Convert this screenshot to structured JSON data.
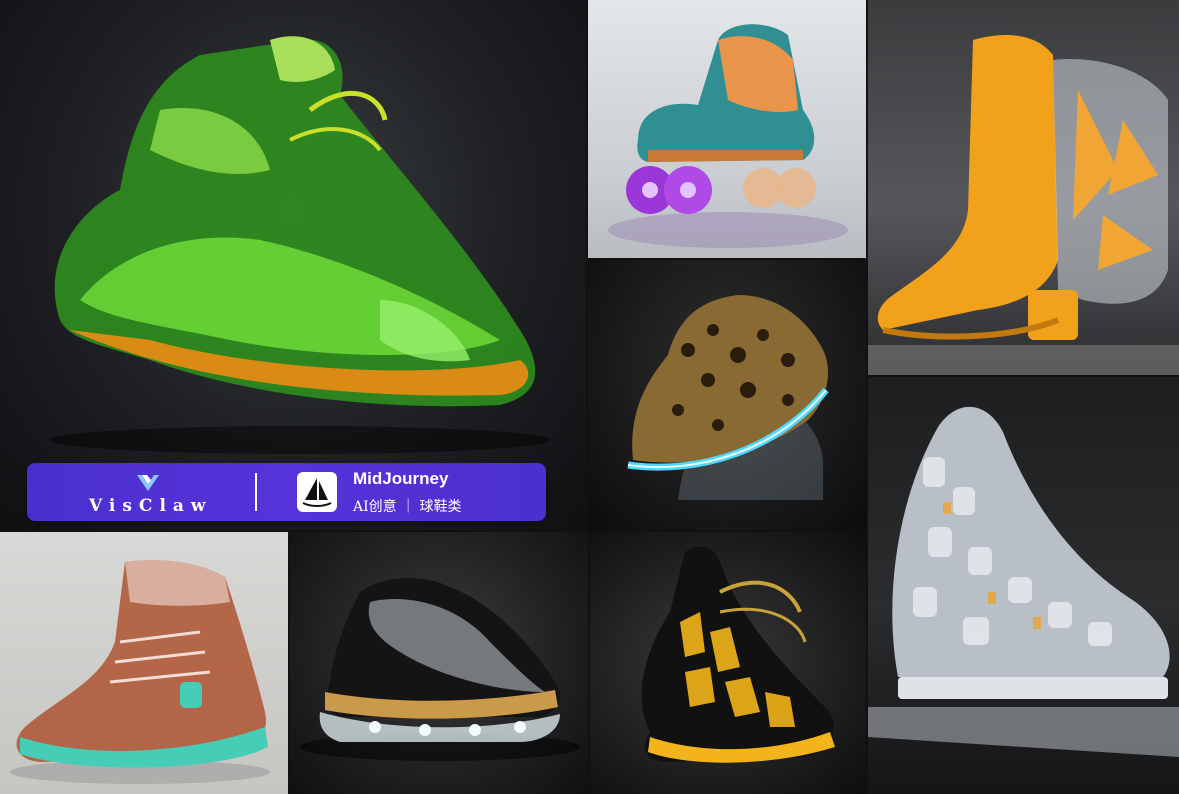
{
  "banner": {
    "brand_name": "VisClaw",
    "brand_icon": "visclaw-v-logo-icon",
    "tool_icon": "midjourney-sailboat-icon",
    "tool_name": "MidJourney",
    "subtitle": "AI创意 ｜ 球鞋类"
  },
  "tiles": [
    {
      "name": "green-glass-high-top-sneaker",
      "accent": "#5fd12a"
    },
    {
      "name": "holographic-roller-skate",
      "accent": "#a13ce0"
    },
    {
      "name": "orange-translucent-boot",
      "accent": "#f2a11b"
    },
    {
      "name": "leopard-led-sneaker",
      "accent": "#4fd8ff"
    },
    {
      "name": "chrome-mosaic-skate-boot",
      "accent": "#c9ced4"
    },
    {
      "name": "copper-teal-glass-boot",
      "accent": "#46cdb5"
    },
    {
      "name": "black-chrome-wave-sneaker",
      "accent": "#c99a4a"
    },
    {
      "name": "black-amber-lattice-sneaker",
      "accent": "#f2b41a"
    }
  ]
}
